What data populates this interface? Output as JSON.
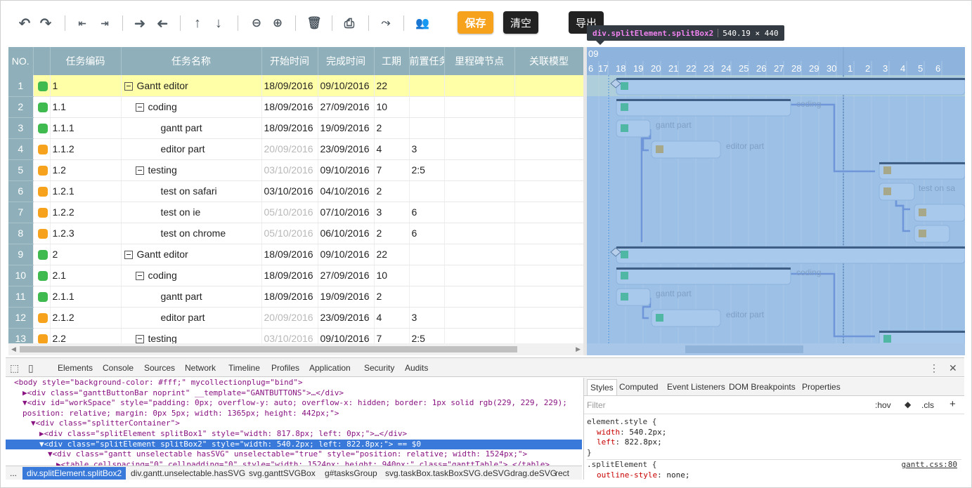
{
  "toolbar": {
    "icons": [
      "undo-icon",
      "redo-icon",
      "outdent-icon",
      "indent-icon",
      "arrow-right-icon",
      "arrow-left-icon",
      "arrow-up-icon",
      "arrow-down-icon",
      "zoom-out-icon",
      "zoom-in-icon",
      "delete-icon",
      "print-icon",
      "link-icon",
      "resources-icon"
    ],
    "save_label": "保存",
    "clear_label": "清空",
    "export_label": "导出"
  },
  "inspect_tooltip": {
    "selector": "div.splitElement.splitBox2",
    "size": "540.19 × 440"
  },
  "grid": {
    "columns": [
      "NO.",
      "",
      "任务编码",
      "任务名称",
      "开始时间",
      "完成时间",
      "工期",
      "前置任务",
      "里程碑节点",
      "关联模型"
    ],
    "rows": [
      {
        "no": "1",
        "status": "green",
        "code": "1",
        "name": "Gantt editor",
        "level": 0,
        "collapsible": true,
        "start": "18/09/2016",
        "start_dim": false,
        "end": "09/10/2016",
        "dur": "22",
        "dep": "",
        "highlight": true
      },
      {
        "no": "2",
        "status": "green",
        "code": "1.1",
        "name": "coding",
        "level": 1,
        "collapsible": true,
        "start": "18/09/2016",
        "start_dim": false,
        "end": "27/09/2016",
        "dur": "10",
        "dep": "",
        "highlight": false
      },
      {
        "no": "3",
        "status": "green",
        "code": "1.1.1",
        "name": "gantt part",
        "level": 2,
        "collapsible": false,
        "start": "18/09/2016",
        "start_dim": false,
        "end": "19/09/2016",
        "dur": "2",
        "dep": "",
        "highlight": false
      },
      {
        "no": "4",
        "status": "orange",
        "code": "1.1.2",
        "name": "editor part",
        "level": 2,
        "collapsible": false,
        "start": "20/09/2016",
        "start_dim": true,
        "end": "23/09/2016",
        "dur": "4",
        "dep": "3",
        "highlight": false
      },
      {
        "no": "5",
        "status": "orange",
        "code": "1.2",
        "name": "testing",
        "level": 1,
        "collapsible": true,
        "start": "03/10/2016",
        "start_dim": true,
        "end": "09/10/2016",
        "dur": "7",
        "dep": "2:5",
        "highlight": false
      },
      {
        "no": "6",
        "status": "orange",
        "code": "1.2.1",
        "name": "test on safari",
        "level": 2,
        "collapsible": false,
        "start": "03/10/2016",
        "start_dim": false,
        "end": "04/10/2016",
        "dur": "2",
        "dep": "",
        "highlight": false
      },
      {
        "no": "7",
        "status": "orange",
        "code": "1.2.2",
        "name": "test on ie",
        "level": 2,
        "collapsible": false,
        "start": "05/10/2016",
        "start_dim": true,
        "end": "07/10/2016",
        "dur": "3",
        "dep": "6",
        "highlight": false
      },
      {
        "no": "8",
        "status": "orange",
        "code": "1.2.3",
        "name": "test on chrome",
        "level": 2,
        "collapsible": false,
        "start": "05/10/2016",
        "start_dim": true,
        "end": "06/10/2016",
        "dur": "2",
        "dep": "6",
        "highlight": false
      },
      {
        "no": "9",
        "status": "green",
        "code": "2",
        "name": "Gantt editor",
        "level": 0,
        "collapsible": true,
        "start": "18/09/2016",
        "start_dim": false,
        "end": "09/10/2016",
        "dur": "22",
        "dep": "",
        "highlight": false
      },
      {
        "no": "10",
        "status": "green",
        "code": "2.1",
        "name": "coding",
        "level": 1,
        "collapsible": true,
        "start": "18/09/2016",
        "start_dim": false,
        "end": "27/09/2016",
        "dur": "10",
        "dep": "",
        "highlight": false
      },
      {
        "no": "11",
        "status": "green",
        "code": "2.1.1",
        "name": "gantt part",
        "level": 2,
        "collapsible": false,
        "start": "18/09/2016",
        "start_dim": false,
        "end": "19/09/2016",
        "dur": "2",
        "dep": "",
        "highlight": false
      },
      {
        "no": "12",
        "status": "orange",
        "code": "2.1.2",
        "name": "editor part",
        "level": 2,
        "collapsible": false,
        "start": "20/09/2016",
        "start_dim": true,
        "end": "23/09/2016",
        "dur": "4",
        "dep": "3",
        "highlight": false
      },
      {
        "no": "13",
        "status": "orange",
        "code": "2.2",
        "name": "testing",
        "level": 1,
        "collapsible": true,
        "start": "03/10/2016",
        "start_dim": true,
        "end": "09/10/2016",
        "dur": "7",
        "dep": "2:5",
        "highlight": false
      }
    ]
  },
  "gantt": {
    "month_label": "09",
    "days": [
      "6",
      "17",
      "18",
      "19",
      "20",
      "21",
      "22",
      "23",
      "24",
      "25",
      "26",
      "27",
      "28",
      "29",
      "30",
      "1",
      "2",
      "3",
      "4",
      "5",
      "6"
    ],
    "bar_labels": {
      "coding": "coding",
      "gantt": "gantt part",
      "editor": "editor part",
      "safari": "test on sa"
    }
  },
  "devtools": {
    "tabs": [
      "Elements",
      "Console",
      "Sources",
      "Network",
      "Timeline",
      "Profiles",
      "Application",
      "Security",
      "Audits"
    ],
    "dom_lines": [
      {
        "indent": 1,
        "text": "<body style=\"background-color: #fff;\" mycollectionplug=\"bind\">",
        "sel": false
      },
      {
        "indent": 2,
        "text": "▶<div class=\"ganttButtonBar noprint\" __template=\"GANTBUTTONS\">…</div>",
        "sel": false
      },
      {
        "indent": 2,
        "text": "▼<div id=\"workSpace\" style=\"padding: 0px; overflow-y: auto; overflow-x: hidden; border: 1px solid rgb(229, 229, 229);",
        "sel": false
      },
      {
        "indent": 2,
        "text": "position: relative; margin: 0px 5px; width: 1365px; height: 442px;\">",
        "sel": false
      },
      {
        "indent": 3,
        "text": "▼<div class=\"splitterContainer\">",
        "sel": false
      },
      {
        "indent": 4,
        "text": "▶<div class=\"splitElement splitBox1\" style=\"width: 817.8px; left: 0px;\">…</div>",
        "sel": false
      },
      {
        "indent": 4,
        "text": "▼<div class=\"splitElement splitBox2\" style=\"width: 540.2px; left: 822.8px;\"> == $0",
        "sel": true
      },
      {
        "indent": 5,
        "text": "▼<div class=\"gantt unselectable hasSVG\" unselectable=\"true\" style=\"position: relative; width: 1524px;\">",
        "sel": false
      },
      {
        "indent": 6,
        "text": "▶<table cellspacing=\"0\" cellpadding=\"0\" style=\"width: 1524px; height: 940px;\" class=\"ganttTable\">…</table>",
        "sel": false
      }
    ],
    "breadcrumbs": [
      "...",
      "div.splitElement.splitBox2",
      "div.gantt.unselectable.hasSVG",
      "svg.ganttSVGBox",
      "g#tasksGroup",
      "svg.taskBox.taskBoxSVG.deSVGdrag.deSVG",
      "rect"
    ],
    "style_tabs": [
      "Styles",
      "Computed",
      "Event Listeners",
      "DOM Breakpoints",
      "Properties"
    ],
    "filter_placeholder": "Filter",
    "hov": ":hov",
    "cls": ".cls",
    "rule1_selector": "element.style {",
    "rule1_props": [
      {
        "p": "width",
        "v": "540.2px;"
      },
      {
        "p": "left",
        "v": "822.8px;"
      }
    ],
    "rule2_selector": ".splitElement {",
    "rule2_source": "gantt.css:80",
    "rule2_prop": {
      "p": "outline-style",
      "v": "none;"
    }
  }
}
